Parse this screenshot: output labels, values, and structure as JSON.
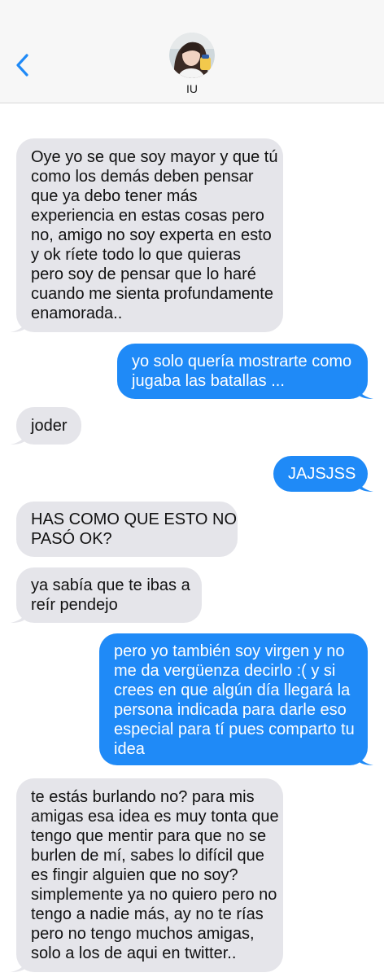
{
  "header": {
    "contact_name": "IU",
    "back_icon": "chevron-left-icon",
    "accent_color": "#1f8af7"
  },
  "messages": [
    {
      "direction": "incoming",
      "lines": [
        "Oye yo se que soy mayor y que tú",
        "como los demás deben pensar",
        "que ya debo tener más",
        "experiencia en estas cosas pero",
        "no, amigo no soy experta en esto",
        "y ok ríete todo lo que quieras",
        "pero soy de pensar que lo haré",
        "cuando me sienta profundamente",
        "enamorada.."
      ]
    },
    {
      "direction": "outgoing",
      "lines": [
        "yo solo quería mostrarte como",
        "jugaba las batallas ..."
      ]
    },
    {
      "direction": "incoming",
      "lines": [
        "joder"
      ]
    },
    {
      "direction": "outgoing",
      "lines": [
        "JAJSJSS"
      ]
    },
    {
      "direction": "incoming",
      "lines": [
        "HAS COMO QUE ESTO NO",
        "PASÓ OK?"
      ]
    },
    {
      "direction": "incoming",
      "lines": [
        "ya sabía que te ibas a",
        "reír pendejo"
      ]
    },
    {
      "direction": "outgoing",
      "lines": [
        "pero yo también soy virgen y no",
        "me da vergüenza decirlo :( y si",
        "crees en que algún día llegará la",
        "persona indicada para darle eso",
        "especial para tí pues comparto tu",
        "idea"
      ]
    },
    {
      "direction": "incoming",
      "lines": [
        "te estás burlando no? para mis",
        "amigas esa idea es muy tonta que",
        "tengo que mentir para que no se",
        "burlen de mí, sabes lo difícil que",
        "es fingir alguien que no soy?",
        "simplemente ya no quiero pero no",
        "tengo a nadie más, ay no te rías",
        "pero no tengo muchos amigas,",
        "solo a los de aqui en twitter.."
      ]
    }
  ]
}
